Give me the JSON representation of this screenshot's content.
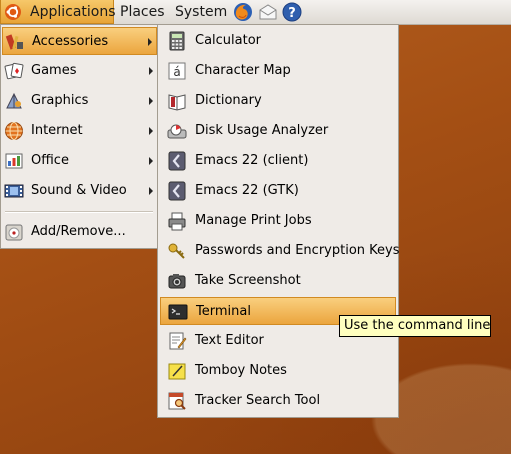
{
  "panel": {
    "menus": [
      {
        "label": "Applications",
        "icon": "ubuntu-logo-icon"
      },
      {
        "label": "Places"
      },
      {
        "label": "System"
      }
    ],
    "launchers": [
      "firefox-icon",
      "mail-icon",
      "help-icon"
    ]
  },
  "applications_menu": {
    "items": [
      {
        "label": "Accessories",
        "icon": "accessories-icon",
        "submenu": true
      },
      {
        "label": "Games",
        "icon": "games-icon",
        "submenu": true
      },
      {
        "label": "Graphics",
        "icon": "graphics-icon",
        "submenu": true
      },
      {
        "label": "Internet",
        "icon": "internet-icon",
        "submenu": true
      },
      {
        "label": "Office",
        "icon": "office-icon",
        "submenu": true
      },
      {
        "label": "Sound & Video",
        "icon": "sound-video-icon",
        "submenu": true
      },
      {
        "label": "Add/Remove...",
        "icon": "add-remove-icon",
        "submenu": false
      }
    ]
  },
  "accessories_menu": {
    "items": [
      {
        "label": "Calculator",
        "icon": "calculator-icon"
      },
      {
        "label": "Character Map",
        "icon": "character-map-icon"
      },
      {
        "label": "Dictionary",
        "icon": "dictionary-icon"
      },
      {
        "label": "Disk Usage Analyzer",
        "icon": "disk-usage-icon"
      },
      {
        "label": "Emacs 22 (client)",
        "icon": "emacs-icon"
      },
      {
        "label": "Emacs 22 (GTK)",
        "icon": "emacs-icon"
      },
      {
        "label": "Manage Print Jobs",
        "icon": "printer-icon"
      },
      {
        "label": "Passwords and Encryption Keys",
        "icon": "keys-icon"
      },
      {
        "label": "Take Screenshot",
        "icon": "camera-icon"
      },
      {
        "label": "Terminal",
        "icon": "terminal-icon"
      },
      {
        "label": "Text Editor",
        "icon": "text-editor-icon"
      },
      {
        "label": "Tomboy Notes",
        "icon": "tomboy-notes-icon"
      },
      {
        "label": "Tracker Search Tool",
        "icon": "tracker-search-icon"
      }
    ]
  },
  "tooltip": {
    "text": "Use the command line"
  },
  "colors": {
    "menu_bg": "#efebe7",
    "highlight": "#eba53e",
    "tooltip_bg": "#ffffbf",
    "desktop": "#a44f14"
  }
}
